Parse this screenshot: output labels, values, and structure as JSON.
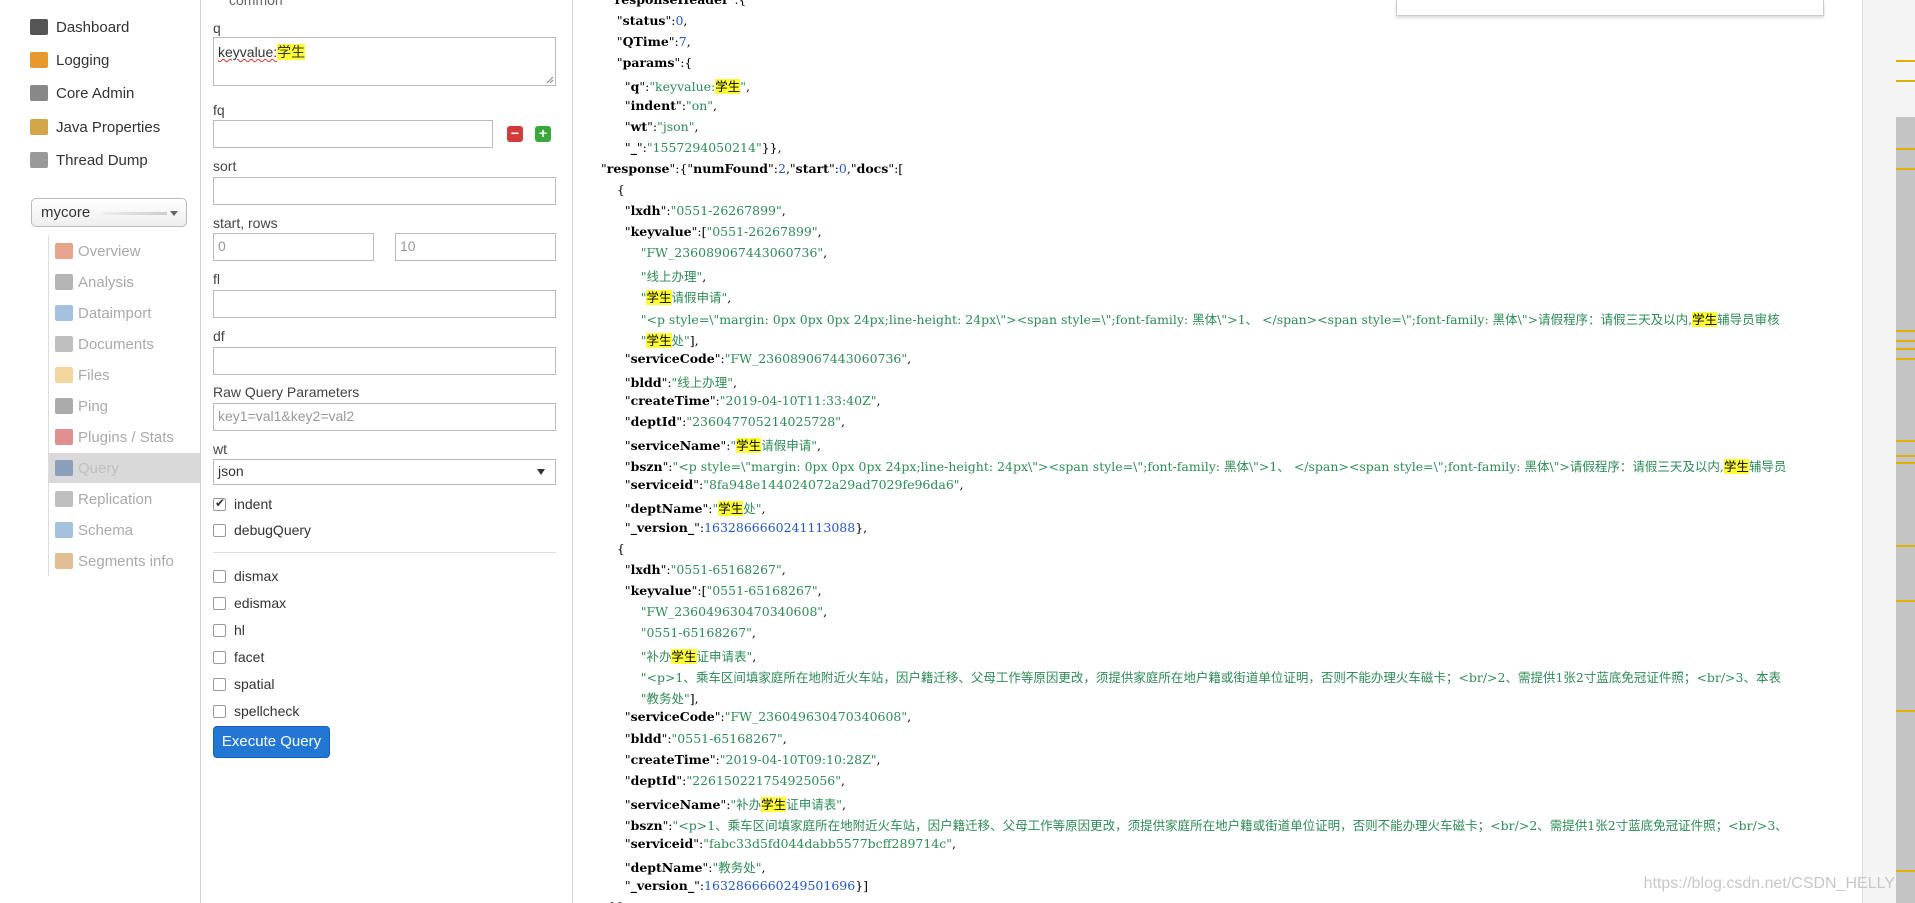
{
  "nav": {
    "items": [
      {
        "label": "Dashboard",
        "icon": "dashboard-icon",
        "color": "#555555"
      },
      {
        "label": "Logging",
        "icon": "logging-icon",
        "color": "#e69a2e"
      },
      {
        "label": "Core Admin",
        "icon": "core-admin-icon",
        "color": "#888888"
      },
      {
        "label": "Java Properties",
        "icon": "java-icon",
        "color": "#d4a64a"
      },
      {
        "label": "Thread Dump",
        "icon": "thread-dump-icon",
        "color": "#999999"
      }
    ],
    "core_selector": "mycore",
    "core_items": [
      {
        "label": "Overview",
        "icon": "home-icon",
        "color": "#d55a2f",
        "active": false
      },
      {
        "label": "Analysis",
        "icon": "funnel-icon",
        "color": "#777777",
        "active": false
      },
      {
        "label": "Dataimport",
        "icon": "dataimport-icon",
        "color": "#5a8fc7",
        "active": false
      },
      {
        "label": "Documents",
        "icon": "documents-icon",
        "color": "#8a8a8a",
        "active": false
      },
      {
        "label": "Files",
        "icon": "files-icon",
        "color": "#e8b84a",
        "active": false
      },
      {
        "label": "Ping",
        "icon": "ping-icon",
        "color": "#666666",
        "active": false
      },
      {
        "label": "Plugins / Stats",
        "icon": "plugins-icon",
        "color": "#c73535",
        "active": false
      },
      {
        "label": "Query",
        "icon": "query-icon",
        "color": "#4a6fa5",
        "active": true
      },
      {
        "label": "Replication",
        "icon": "replication-icon",
        "color": "#888888",
        "active": false
      },
      {
        "label": "Schema",
        "icon": "schema-icon",
        "color": "#5a8fc7",
        "active": false
      },
      {
        "label": "Segments info",
        "icon": "segments-icon",
        "color": "#c98b3a",
        "active": false
      }
    ]
  },
  "form": {
    "section_label": "common",
    "q_label": "q",
    "q_value_prefix": "keyvalue:",
    "q_value_highlight": "学生",
    "fq_label": "fq",
    "sort_label": "sort",
    "start_rows_label": "start, rows",
    "start_placeholder": "0",
    "rows_placeholder": "10",
    "fl_label": "fl",
    "df_label": "df",
    "raw_label": "Raw Query Parameters",
    "raw_placeholder": "key1=val1&key2=val2",
    "wt_label": "wt",
    "wt_value": "json",
    "checkboxes": [
      {
        "label": "indent",
        "checked": true
      },
      {
        "label": "debugQuery",
        "checked": false
      }
    ],
    "checkboxes2": [
      {
        "label": "dismax",
        "checked": false
      },
      {
        "label": "edismax",
        "checked": false
      },
      {
        "label": "hl",
        "checked": false
      },
      {
        "label": "facet",
        "checked": false
      },
      {
        "label": "spatial",
        "checked": false
      },
      {
        "label": "spellcheck",
        "checked": false
      }
    ],
    "execute_label": "Execute Query"
  },
  "response": {
    "lines": [
      [
        [
          "p",
          "  \""
        ],
        [
          "k",
          "responseHeader"
        ],
        [
          "p",
          "\":{"
        ]
      ],
      [
        [
          "p",
          "    \""
        ],
        [
          "k",
          "status"
        ],
        [
          "p",
          "\":"
        ],
        [
          "n",
          "0"
        ],
        [
          "p",
          ","
        ]
      ],
      [
        [
          "p",
          "    \""
        ],
        [
          "k",
          "QTime"
        ],
        [
          "p",
          "\":"
        ],
        [
          "n",
          "7"
        ],
        [
          "p",
          ","
        ]
      ],
      [
        [
          "p",
          "    \""
        ],
        [
          "k",
          "params"
        ],
        [
          "p",
          "\":{"
        ]
      ],
      [
        [
          "p",
          "      \""
        ],
        [
          "k",
          "q"
        ],
        [
          "p",
          "\":"
        ],
        [
          "s",
          "\"keyvalue:"
        ],
        [
          "h",
          "学生"
        ],
        [
          "s",
          "\""
        ],
        [
          "p",
          ","
        ]
      ],
      [
        [
          "p",
          "      \""
        ],
        [
          "k",
          "indent"
        ],
        [
          "p",
          "\":"
        ],
        [
          "s",
          "\"on\""
        ],
        [
          "p",
          ","
        ]
      ],
      [
        [
          "p",
          "      \""
        ],
        [
          "k",
          "wt"
        ],
        [
          "p",
          "\":"
        ],
        [
          "s",
          "\"json\""
        ],
        [
          "p",
          ","
        ]
      ],
      [
        [
          "p",
          "      \""
        ],
        [
          "k",
          "_"
        ],
        [
          "p",
          "\":"
        ],
        [
          "s",
          "\"1557294050214\""
        ],
        [
          "p",
          "}},"
        ]
      ],
      [
        [
          "p",
          "\""
        ],
        [
          "k",
          "response"
        ],
        [
          "p",
          "\":{\""
        ],
        [
          "k",
          "numFound"
        ],
        [
          "p",
          "\":"
        ],
        [
          "n",
          "2"
        ],
        [
          "p",
          ",\""
        ],
        [
          "k",
          "start"
        ],
        [
          "p",
          "\":"
        ],
        [
          "n",
          "0"
        ],
        [
          "p",
          ",\""
        ],
        [
          "k",
          "docs"
        ],
        [
          "p",
          "\":["
        ]
      ],
      [
        [
          "p",
          "    {"
        ]
      ],
      [
        [
          "p",
          "      \""
        ],
        [
          "k",
          "lxdh"
        ],
        [
          "p",
          "\":"
        ],
        [
          "s",
          "\"0551-26267899\""
        ],
        [
          "p",
          ","
        ]
      ],
      [
        [
          "p",
          "      \""
        ],
        [
          "k",
          "keyvalue"
        ],
        [
          "p",
          "\":["
        ],
        [
          "s",
          "\"0551-26267899\""
        ],
        [
          "p",
          ","
        ]
      ],
      [
        [
          "s",
          "          \"FW_236089067443060736\""
        ],
        [
          "p",
          ","
        ]
      ],
      [
        [
          "s",
          "          \"线上办理\""
        ],
        [
          "p",
          ","
        ]
      ],
      [
        [
          "s",
          "          \""
        ],
        [
          "h",
          "学生"
        ],
        [
          "s",
          "请假申请\""
        ],
        [
          "p",
          ","
        ]
      ],
      [
        [
          "s",
          "          \"<p style=\\\"margin: 0px 0px 0px 24px;line-height: 24px\\\"><span style=\\\";font-family: 黑体\\\">1、 </span><span style=\\\";font-family: 黑体\\\">请假程序：请假三天及以内,"
        ],
        [
          "h",
          "学生"
        ],
        [
          "s",
          "辅导员审核"
        ]
      ],
      [
        [
          "s",
          "          \""
        ],
        [
          "h",
          "学生"
        ],
        [
          "s",
          "处\""
        ],
        [
          "p",
          "],"
        ]
      ],
      [
        [
          "p",
          "      \""
        ],
        [
          "k",
          "serviceCode"
        ],
        [
          "p",
          "\":"
        ],
        [
          "s",
          "\"FW_236089067443060736\""
        ],
        [
          "p",
          ","
        ]
      ],
      [
        [
          "p",
          "      \""
        ],
        [
          "k",
          "bldd"
        ],
        [
          "p",
          "\":"
        ],
        [
          "s",
          "\"线上办理\""
        ],
        [
          "p",
          ","
        ]
      ],
      [
        [
          "p",
          "      \""
        ],
        [
          "k",
          "createTime"
        ],
        [
          "p",
          "\":"
        ],
        [
          "s",
          "\"2019-04-10T11:33:40Z\""
        ],
        [
          "p",
          ","
        ]
      ],
      [
        [
          "p",
          "      \""
        ],
        [
          "k",
          "deptId"
        ],
        [
          "p",
          "\":"
        ],
        [
          "s",
          "\"236047705214025728\""
        ],
        [
          "p",
          ","
        ]
      ],
      [
        [
          "p",
          "      \""
        ],
        [
          "k",
          "serviceName"
        ],
        [
          "p",
          "\":"
        ],
        [
          "s",
          "\""
        ],
        [
          "h",
          "学生"
        ],
        [
          "s",
          "请假申请\""
        ],
        [
          "p",
          ","
        ]
      ],
      [
        [
          "p",
          "      \""
        ],
        [
          "k",
          "bszn"
        ],
        [
          "p",
          "\":"
        ],
        [
          "s",
          "\"<p style=\\\"margin: 0px 0px 0px 24px;line-height: 24px\\\"><span style=\\\";font-family: 黑体\\\">1、 </span><span style=\\\";font-family: 黑体\\\">请假程序：请假三天及以内,"
        ],
        [
          "h",
          "学生"
        ],
        [
          "s",
          "辅导员"
        ]
      ],
      [
        [
          "p",
          "      \""
        ],
        [
          "k",
          "serviceid"
        ],
        [
          "p",
          "\":"
        ],
        [
          "s",
          "\"8fa948e144024072a29ad7029fe96da6\""
        ],
        [
          "p",
          ","
        ]
      ],
      [
        [
          "p",
          "      \""
        ],
        [
          "k",
          "deptName"
        ],
        [
          "p",
          "\":"
        ],
        [
          "s",
          "\""
        ],
        [
          "h",
          "学生"
        ],
        [
          "s",
          "处\""
        ],
        [
          "p",
          ","
        ]
      ],
      [
        [
          "p",
          "      \""
        ],
        [
          "k",
          "_version_"
        ],
        [
          "p",
          "\":"
        ],
        [
          "n",
          "1632866660241113088"
        ],
        [
          "p",
          "},"
        ]
      ],
      [
        [
          "p",
          "    {"
        ]
      ],
      [
        [
          "p",
          "      \""
        ],
        [
          "k",
          "lxdh"
        ],
        [
          "p",
          "\":"
        ],
        [
          "s",
          "\"0551-65168267\""
        ],
        [
          "p",
          ","
        ]
      ],
      [
        [
          "p",
          "      \""
        ],
        [
          "k",
          "keyvalue"
        ],
        [
          "p",
          "\":["
        ],
        [
          "s",
          "\"0551-65168267\""
        ],
        [
          "p",
          ","
        ]
      ],
      [
        [
          "s",
          "          \"FW_236049630470340608\""
        ],
        [
          "p",
          ","
        ]
      ],
      [
        [
          "s",
          "          \"0551-65168267\""
        ],
        [
          "p",
          ","
        ]
      ],
      [
        [
          "s",
          "          \"补办"
        ],
        [
          "h",
          "学生"
        ],
        [
          "s",
          "证申请表\""
        ],
        [
          "p",
          ","
        ]
      ],
      [
        [
          "s",
          "          \"<p>1、乘车区间填家庭所在地附近火车站，因户籍迁移、父母工作等原因更改，须提供家庭所在地户籍或街道单位证明，否则不能办理火车磁卡；<br/>2、需提供1张2寸蓝底免冠证件照；<br/>3、本表"
        ]
      ],
      [
        [
          "s",
          "          \"教务处\""
        ],
        [
          "p",
          "],"
        ]
      ],
      [
        [
          "p",
          "      \""
        ],
        [
          "k",
          "serviceCode"
        ],
        [
          "p",
          "\":"
        ],
        [
          "s",
          "\"FW_236049630470340608\""
        ],
        [
          "p",
          ","
        ]
      ],
      [
        [
          "p",
          "      \""
        ],
        [
          "k",
          "bldd"
        ],
        [
          "p",
          "\":"
        ],
        [
          "s",
          "\"0551-65168267\""
        ],
        [
          "p",
          ","
        ]
      ],
      [
        [
          "p",
          "      \""
        ],
        [
          "k",
          "createTime"
        ],
        [
          "p",
          "\":"
        ],
        [
          "s",
          "\"2019-04-10T09:10:28Z\""
        ],
        [
          "p",
          ","
        ]
      ],
      [
        [
          "p",
          "      \""
        ],
        [
          "k",
          "deptId"
        ],
        [
          "p",
          "\":"
        ],
        [
          "s",
          "\"226150221754925056\""
        ],
        [
          "p",
          ","
        ]
      ],
      [
        [
          "p",
          "      \""
        ],
        [
          "k",
          "serviceName"
        ],
        [
          "p",
          "\":"
        ],
        [
          "s",
          "\"补办"
        ],
        [
          "h",
          "学生"
        ],
        [
          "s",
          "证申请表\""
        ],
        [
          "p",
          ","
        ]
      ],
      [
        [
          "p",
          "      \""
        ],
        [
          "k",
          "bszn"
        ],
        [
          "p",
          "\":"
        ],
        [
          "s",
          "\"<p>1、乘车区间填家庭所在地附近火车站，因户籍迁移、父母工作等原因更改，须提供家庭所在地户籍或街道单位证明，否则不能办理火车磁卡；<br/>2、需提供1张2寸蓝底免冠证件照；<br/>3、"
        ]
      ],
      [
        [
          "p",
          "      \""
        ],
        [
          "k",
          "serviceid"
        ],
        [
          "p",
          "\":"
        ],
        [
          "s",
          "\"fabc33d5fd044dabb5577bcff289714c\""
        ],
        [
          "p",
          ","
        ]
      ],
      [
        [
          "p",
          "      \""
        ],
        [
          "k",
          "deptName"
        ],
        [
          "p",
          "\":"
        ],
        [
          "s",
          "\"教务处\""
        ],
        [
          "p",
          ","
        ]
      ],
      [
        [
          "p",
          "      \""
        ],
        [
          "k",
          "_version_"
        ],
        [
          "p",
          "\":"
        ],
        [
          "n",
          "1632866660249501696"
        ],
        [
          "p",
          "}]"
        ]
      ],
      [
        [
          "p",
          "  }}"
        ]
      ]
    ]
  },
  "watermark": "https://blog.csdn.net/CSDN_HELLY",
  "colors": {
    "accent": "#2277d4",
    "highlight": "#ffff33",
    "string": "#2e8b57",
    "number": "#2557c5",
    "marker": "#e0b000"
  }
}
